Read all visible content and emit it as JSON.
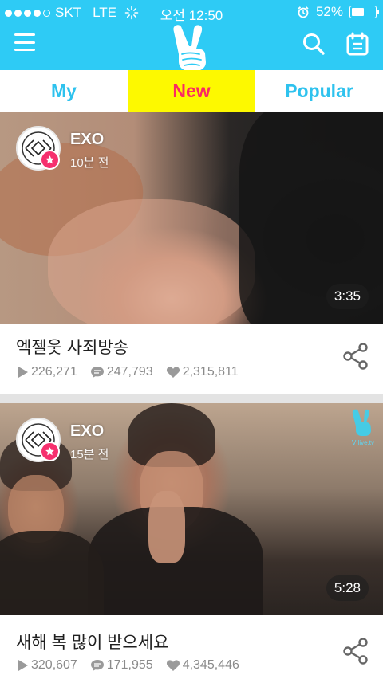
{
  "status_bar": {
    "carrier": "SKT",
    "network": "LTE",
    "time": "오전 12:50",
    "battery_percent": "52%",
    "battery_level": 0.52,
    "signal_dots": 4
  },
  "header": {
    "menu_icon": "hamburger-menu-icon",
    "logo_icon": "v-victory-hand-logo-icon",
    "search_icon": "search-icon",
    "schedule_icon": "calendar-icon"
  },
  "tabs": [
    {
      "label": "My",
      "active": false
    },
    {
      "label": "New",
      "active": true
    },
    {
      "label": "Popular",
      "active": false
    }
  ],
  "colors": {
    "brand": "#2ecbf5",
    "tab_active_bg": "#fdf900",
    "tab_active_text": "#fb2a63",
    "tab_text": "#2ec2ee",
    "badge": "#f6306e"
  },
  "feed": [
    {
      "channel": "EXO",
      "time_ago": "10분 전",
      "duration": "3:35",
      "title": "엑젤웃 사죄방송",
      "plays": "226,271",
      "comments": "247,793",
      "likes": "2,315,811"
    },
    {
      "channel": "EXO",
      "time_ago": "15분 전",
      "duration": "5:28",
      "title": "새해 복 많이 받으세요",
      "plays": "320,607",
      "comments": "171,955",
      "likes": "4,345,446",
      "watermark": "V live.tv"
    }
  ]
}
